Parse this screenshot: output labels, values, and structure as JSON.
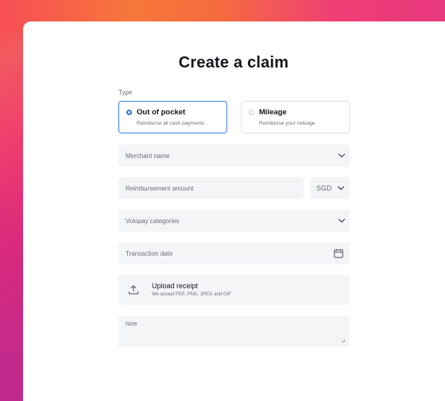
{
  "form": {
    "title": "Create a claim",
    "type_label": "Type",
    "types": [
      {
        "title": "Out of pocket",
        "subtitle": "Reimburse all cash payments",
        "selected": true
      },
      {
        "title": "Mileage",
        "subtitle": "Reimburse your mileage",
        "selected": false
      }
    ],
    "merchant": {
      "placeholder": "Merchant name",
      "icon": "chevron-down-icon"
    },
    "amount": {
      "placeholder": "Reimbursement amount",
      "currency": "SGD",
      "icon": "chevron-down-icon"
    },
    "categories": {
      "placeholder": "Volopay categories",
      "icon": "chevron-down-icon"
    },
    "date": {
      "placeholder": "Transaction date",
      "icon": "calendar-icon"
    },
    "upload": {
      "title": "Upload receipt",
      "subtitle": "We accept PDF, PNG, JPEG and GIF",
      "icon": "upload-icon"
    },
    "note": {
      "placeholder": "Note"
    }
  },
  "colors": {
    "accent": "#3f82e6",
    "field_bg": "#f4f5f7"
  }
}
